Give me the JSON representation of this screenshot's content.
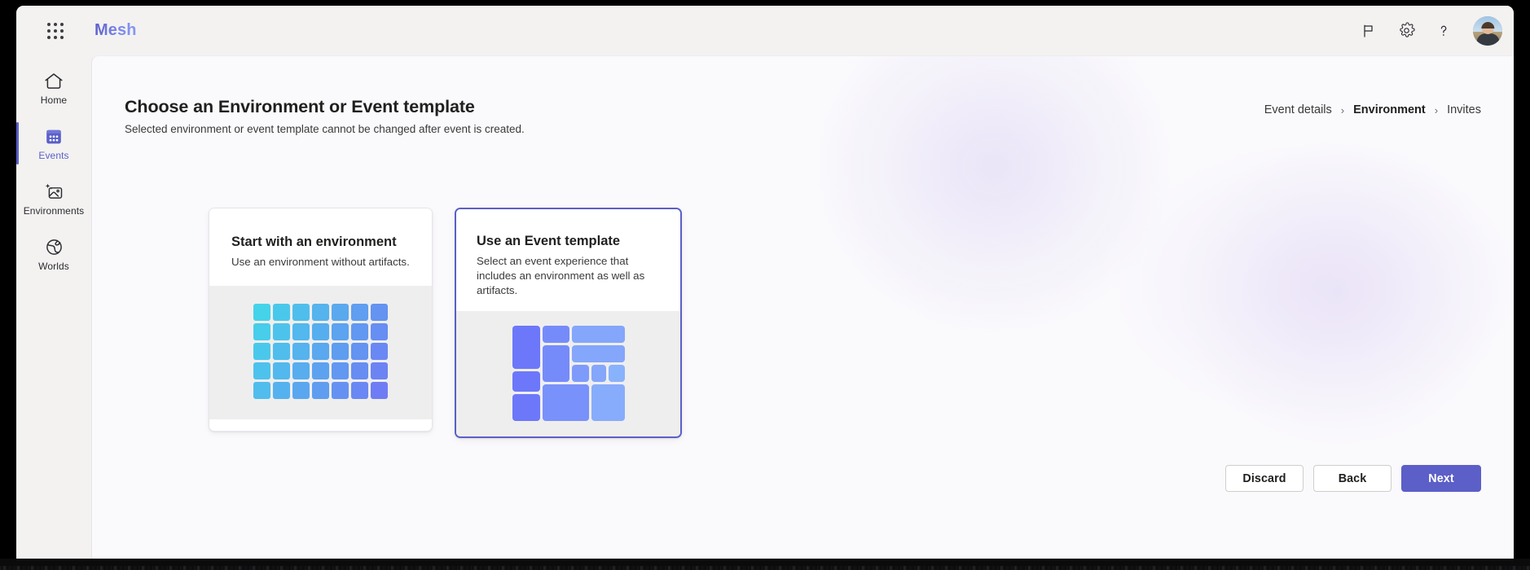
{
  "topbar": {
    "waffle_icon": "app-launcher-waffle-icon",
    "brand": "Mesh",
    "actions": [
      {
        "name": "feedback-flag-icon",
        "label": "Feedback"
      },
      {
        "name": "settings-gear-icon",
        "label": "Settings"
      },
      {
        "name": "help-question-icon",
        "label": "Help"
      }
    ],
    "avatar_label": "Account manager"
  },
  "sidebar": {
    "items": [
      {
        "label": "Home",
        "icon": "home-icon",
        "active": false
      },
      {
        "label": "Events",
        "icon": "calendar-events-icon",
        "active": true
      },
      {
        "label": "Environments",
        "icon": "image-sparkle-icon",
        "active": false
      },
      {
        "label": "Worlds",
        "icon": "globe-icon",
        "active": false
      }
    ]
  },
  "page": {
    "title": "Choose an Environment or Event template",
    "subtitle": "Selected environment or event template cannot be changed after event is created."
  },
  "breadcrumb": {
    "items": [
      {
        "label": "Event details",
        "current": false
      },
      {
        "label": "Environment",
        "current": true
      },
      {
        "label": "Invites",
        "current": false
      }
    ],
    "separator": "›"
  },
  "cards": [
    {
      "title": "Start with an environment",
      "description": "Use an environment without artifacts.",
      "selected": false,
      "art": "grid-tiles"
    },
    {
      "title": "Use an Event template",
      "description": "Select an event experience that includes an environment as well as artifacts.",
      "selected": true,
      "art": "mosaic-tiles"
    }
  ],
  "footer": {
    "discard_label": "Discard",
    "back_label": "Back",
    "next_label": "Next"
  },
  "colors": {
    "accent": "#5b5fc7",
    "brand_text": "#5b5fc7",
    "card_art_bg": "#efeeee",
    "page_bg": "#faf9fc",
    "rail_bg": "#f3f2f1",
    "grid_art_from": "#45d3ea",
    "grid_art_to": "#6f7df4",
    "mosaic_from": "#6a71f8",
    "mosaic_to": "#87b3fb"
  }
}
